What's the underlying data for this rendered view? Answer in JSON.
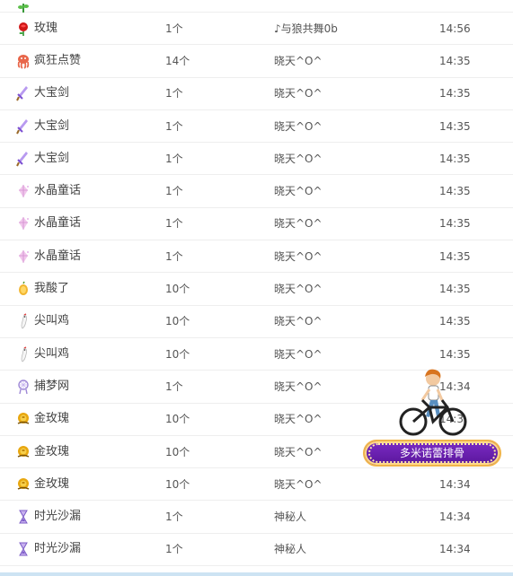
{
  "gift_rows": [
    {
      "name": "玫瑰",
      "count": "1个",
      "sender": "♪与狼共舞0b",
      "time": "14:56",
      "icon": "rose-icon"
    },
    {
      "name": "疯狂点赞",
      "count": "14个",
      "sender": "晓天^O^",
      "time": "14:35",
      "icon": "octopus-icon"
    },
    {
      "name": "大宝剑",
      "count": "1个",
      "sender": "晓天^O^",
      "time": "14:35",
      "icon": "sword-icon"
    },
    {
      "name": "大宝剑",
      "count": "1个",
      "sender": "晓天^O^",
      "time": "14:35",
      "icon": "sword-icon"
    },
    {
      "name": "大宝剑",
      "count": "1个",
      "sender": "晓天^O^",
      "time": "14:35",
      "icon": "sword-icon"
    },
    {
      "name": "水晶童话",
      "count": "1个",
      "sender": "晓天^O^",
      "time": "14:35",
      "icon": "crystal-icon"
    },
    {
      "name": "水晶童话",
      "count": "1个",
      "sender": "晓天^O^",
      "time": "14:35",
      "icon": "crystal-icon"
    },
    {
      "name": "水晶童话",
      "count": "1个",
      "sender": "晓天^O^",
      "time": "14:35",
      "icon": "crystal-icon"
    },
    {
      "name": "我酸了",
      "count": "10个",
      "sender": "晓天^O^",
      "time": "14:35",
      "icon": "lemon-icon"
    },
    {
      "name": "尖叫鸡",
      "count": "10个",
      "sender": "晓天^O^",
      "time": "14:35",
      "icon": "chicken-icon"
    },
    {
      "name": "尖叫鸡",
      "count": "10个",
      "sender": "晓天^O^",
      "time": "14:35",
      "icon": "chicken-icon"
    },
    {
      "name": "捕梦网",
      "count": "1个",
      "sender": "晓天^O^",
      "time": "14:34",
      "icon": "dreamcatcher-icon"
    },
    {
      "name": "金玫瑰",
      "count": "10个",
      "sender": "晓天^O^",
      "time": "14:3",
      "icon": "gold-rose-icon"
    },
    {
      "name": "金玫瑰",
      "count": "10个",
      "sender": "晓天^O^",
      "time": "",
      "icon": "gold-rose-icon"
    },
    {
      "name": "金玫瑰",
      "count": "10个",
      "sender": "晓天^O^",
      "time": "14:34",
      "icon": "gold-rose-icon"
    },
    {
      "name": "时光沙漏",
      "count": "1个",
      "sender": "神秘人",
      "time": "14:34",
      "icon": "hourglass-icon"
    },
    {
      "name": "时光沙漏",
      "count": "1个",
      "sender": "神秘人",
      "time": "14:34",
      "icon": "hourglass-icon"
    }
  ],
  "floating_widget": {
    "button_label": "多米诺蕾排骨"
  },
  "colors": {
    "row_border": "#eeeeee",
    "text": "#555555",
    "button_purple": "#6a1fb0",
    "button_border": "#f0b44a"
  }
}
